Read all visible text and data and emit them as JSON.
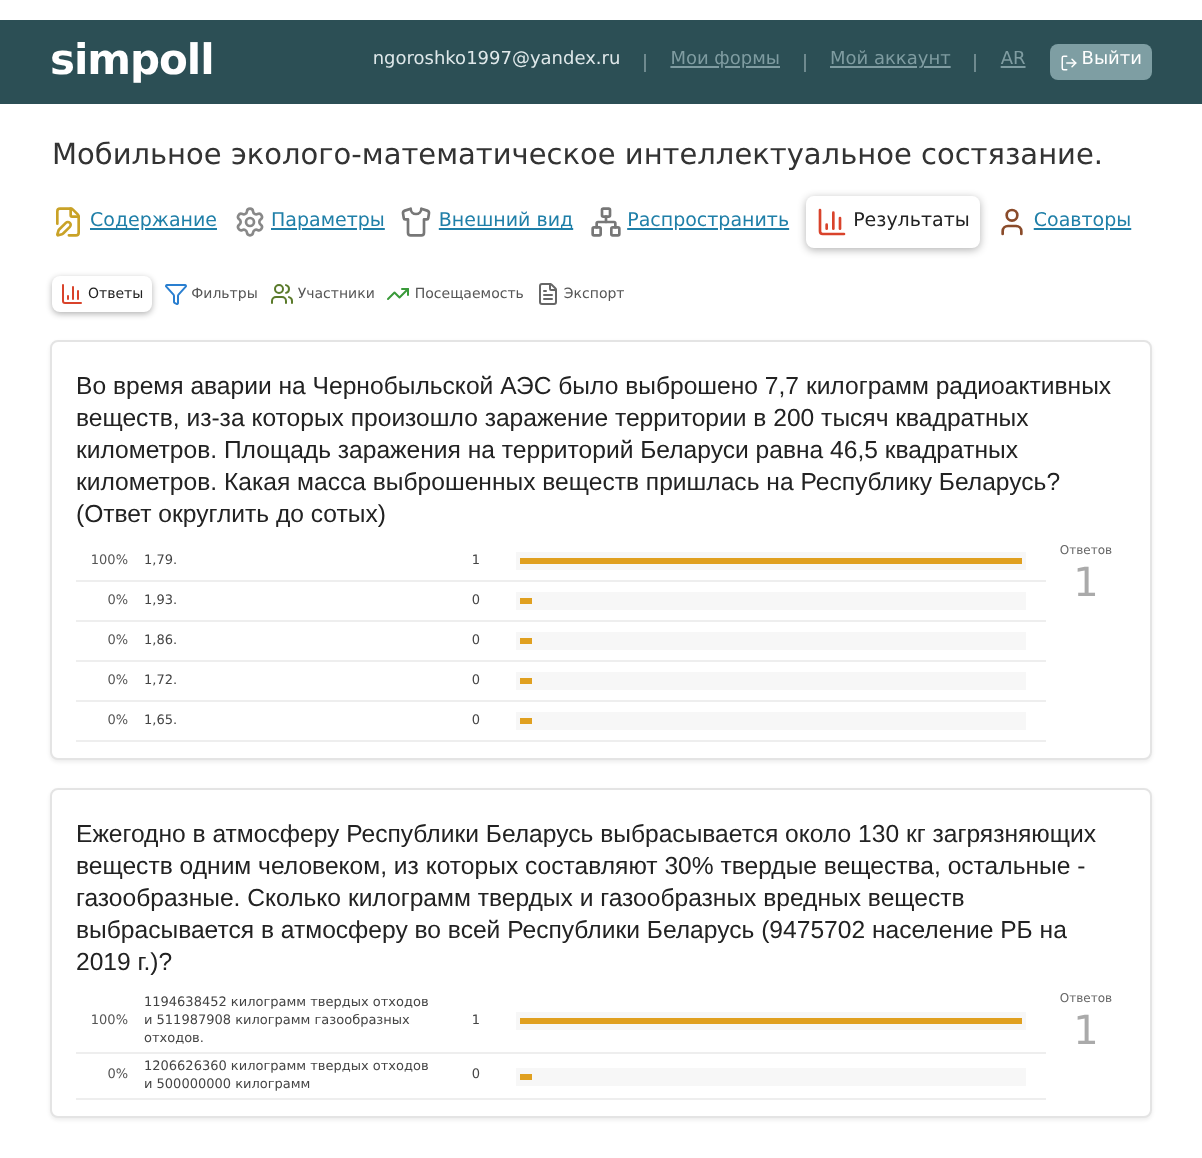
{
  "header": {
    "logo": "simpoll",
    "email": "ngoroshko1997@yandex.ru",
    "links": [
      "Мои формы",
      "Мой аккаунт",
      "AR"
    ],
    "logout": "Выйти"
  },
  "title": "Мобильное эколого-математическое интеллектуальное состязание.",
  "tabs": [
    {
      "label": "Содержание",
      "kind": "content",
      "selected": false
    },
    {
      "label": "Параметры",
      "kind": "settings",
      "selected": false
    },
    {
      "label": "Внешний вид",
      "kind": "appearance",
      "selected": false
    },
    {
      "label": "Распространить",
      "kind": "share",
      "selected": false
    },
    {
      "label": "Результаты",
      "kind": "results",
      "selected": true
    },
    {
      "label": "Соавторы",
      "kind": "coauthors",
      "selected": false
    }
  ],
  "subtabs": [
    {
      "label": "Ответы",
      "kind": "answers",
      "selected": true
    },
    {
      "label": "Фильтры",
      "kind": "filters",
      "selected": false
    },
    {
      "label": "Участники",
      "kind": "participants",
      "selected": false
    },
    {
      "label": "Посещаемость",
      "kind": "attendance",
      "selected": false
    },
    {
      "label": "Экспорт",
      "kind": "export",
      "selected": false
    }
  ],
  "questions": [
    {
      "text": "Во время аварии на Чернобыльской АЭС было выброшено 7,7 килограмм радиоактивных веществ, из-за которых произошло заражение территории в 200 тысяч квадратных километров. Площадь заражения на территорий Беларуси равна 46,5 квадратных километров. Какая масса выброшенных веществ пришлась на Республику Беларусь? (Ответ округлить до сотых)",
      "answers_label": "Ответов",
      "answers_total": "1",
      "answers": [
        {
          "percent": "100%",
          "label": "1,79.",
          "count": "1",
          "level": 1
        },
        {
          "percent": "0%",
          "label": "1,93.",
          "count": "0",
          "level": 0
        },
        {
          "percent": "0%",
          "label": "1,86.",
          "count": "0",
          "level": 0
        },
        {
          "percent": "0%",
          "label": "1,72.",
          "count": "0",
          "level": 0
        },
        {
          "percent": "0%",
          "label": "1,65.",
          "count": "0",
          "level": 0
        }
      ]
    },
    {
      "text": "Ежегодно в атмосферу Республики Беларусь выбрасывается около 130 кг загрязняющих веществ одним человеком, из которых составляют 30% твердые вещества, остальные - газообразные. Сколько килограмм твердых и газообразных вредных веществ выбрасывается в атмосферу во всей Республики Беларусь (9475702 население РБ на 2019 г.)?",
      "answers_label": "Ответов",
      "answers_total": "1",
      "answers": [
        {
          "percent": "100%",
          "label": "1194638452 килограмм твердых отходов и 511987908 килограмм газообразных отходов.",
          "count": "1",
          "level": 1
        },
        {
          "percent": "0%",
          "label": "1206626360 килограмм твердых отходов и 500000000 килограмм",
          "count": "0",
          "level": 0
        }
      ]
    }
  ]
}
